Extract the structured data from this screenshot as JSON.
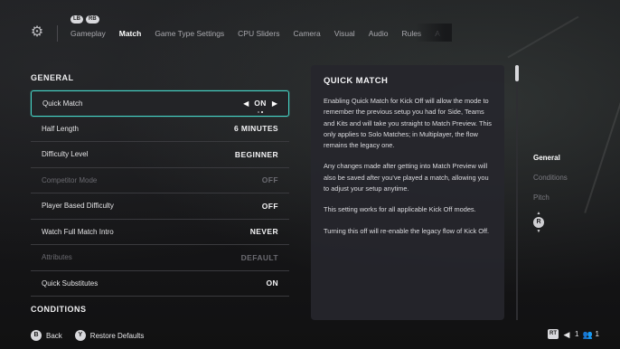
{
  "header": {
    "shoulder_buttons": [
      "LB",
      "RB"
    ],
    "tabs": [
      {
        "label": "Gameplay"
      },
      {
        "label": "Match"
      },
      {
        "label": "Game Type Settings"
      },
      {
        "label": "CPU Sliders"
      },
      {
        "label": "Camera"
      },
      {
        "label": "Visual"
      },
      {
        "label": "Audio"
      },
      {
        "label": "Rules"
      },
      {
        "label": "A"
      }
    ],
    "active_tab": "Match"
  },
  "sections": {
    "general_title": "GENERAL",
    "conditions_title": "CONDITIONS"
  },
  "settings": [
    {
      "label": "Quick Match",
      "value": "ON",
      "state": "selected"
    },
    {
      "label": "Half Length",
      "value": "6 MINUTES",
      "state": "normal"
    },
    {
      "label": "Difficulty Level",
      "value": "BEGINNER",
      "state": "normal"
    },
    {
      "label": "Competitor Mode",
      "value": "OFF",
      "state": "disabled"
    },
    {
      "label": "Player Based Difficulty",
      "value": "OFF",
      "state": "normal"
    },
    {
      "label": "Watch Full Match Intro",
      "value": "NEVER",
      "state": "normal"
    },
    {
      "label": "Attributes",
      "value": "DEFAULT",
      "state": "disabled"
    },
    {
      "label": "Quick Substitutes",
      "value": "ON",
      "state": "normal"
    }
  ],
  "description": {
    "title": "QUICK MATCH",
    "paragraphs": [
      "Enabling Quick Match for Kick Off will allow the mode to remember the previous setup you had for Side, Teams and Kits and will take you straight to Match Preview. This only applies to Solo Matches; in Multiplayer, the flow remains the legacy one.",
      "Any changes made after getting into Match Preview will also be saved after you've played a match, allowing you to adjust your setup anytime.",
      "This setting works for all applicable Kick Off modes.",
      "Turning this off will re-enable the legacy flow of Kick Off."
    ]
  },
  "side_nav": {
    "items": [
      "General",
      "Conditions",
      "Pitch"
    ],
    "active": "General",
    "stick_label": "R"
  },
  "footer": {
    "back_button": "B",
    "back_label": "Back",
    "restore_button": "Y",
    "restore_label": "Restore Defaults",
    "rt_label": "RT",
    "voice_count": "1",
    "players_count": "1"
  },
  "colors": {
    "accent": "#47d7c9",
    "panel_bg": "#26262c",
    "background": "#141416"
  }
}
